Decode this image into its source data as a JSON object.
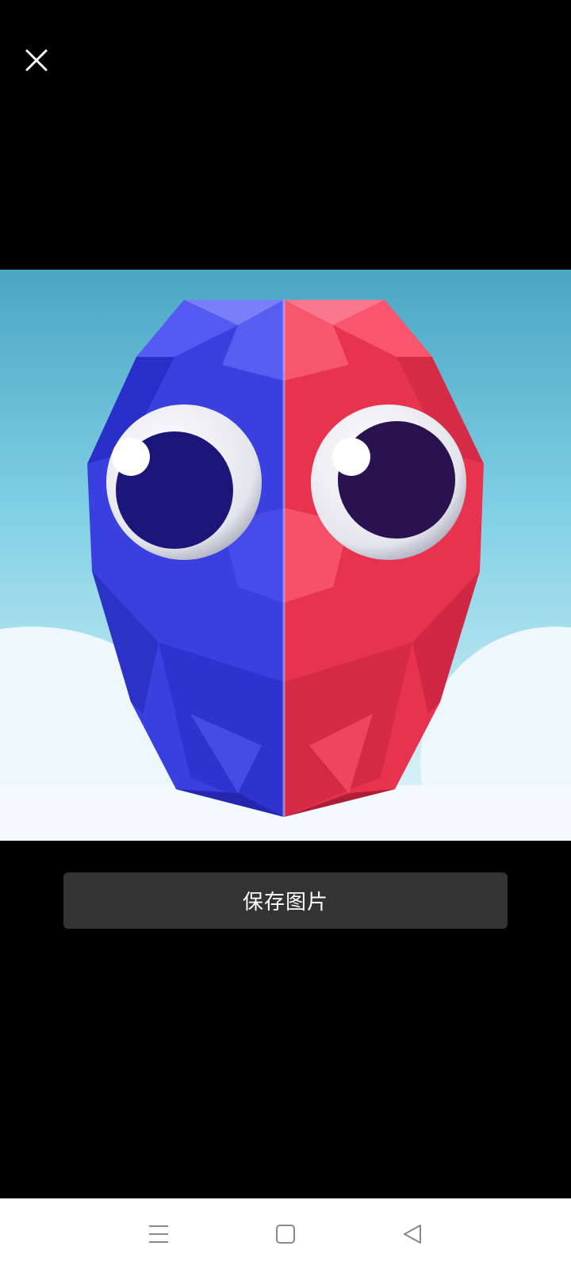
{
  "viewer": {
    "close_icon": "close-icon",
    "image_subject": "red-blue-gem-face"
  },
  "actions": {
    "save_label": "保存图片"
  },
  "nav_bar": {
    "items": [
      {
        "icon": "menu-icon"
      },
      {
        "icon": "home-square-icon"
      },
      {
        "icon": "back-triangle-icon"
      }
    ]
  },
  "colors": {
    "background": "#000000",
    "button_bg": "#333333",
    "button_text": "#ffffff",
    "nav_bg": "#ffffff",
    "nav_icon": "#888888",
    "gem_blue": "#3a3fe0",
    "gem_red": "#e8334f"
  }
}
